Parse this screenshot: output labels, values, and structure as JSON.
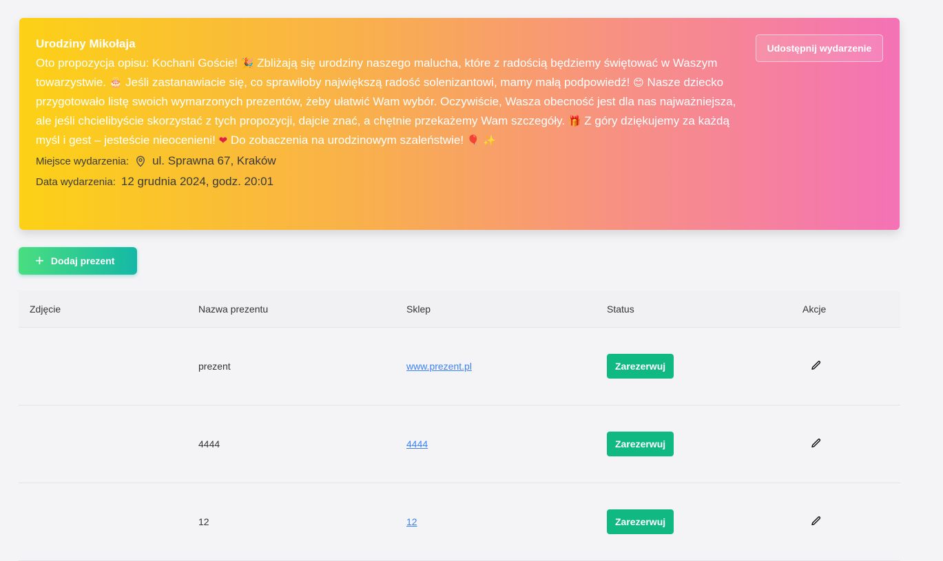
{
  "event": {
    "title": "Urodziny Mikołaja",
    "description_parts": [
      "Oto propozycja opisu: Kochani Goście! ",
      " Zbliżają się urodziny naszego malucha, które z radością będziemy świętować w Waszym towarzystwie. ",
      " Jeśli zastanawiacie się, co sprawiłoby największą radość solenizantowi, mamy małą podpowiedź! ",
      " Nasze dziecko przygotowało listę swoich wymarzonych prezentów, żeby ułatwić Wam wybór. Oczywiście, Wasza obecność jest dla nas najważniejsza, ale jeśli chcielibyście skorzystać z tych propozycji, dajcie znać, a chętnie przekażemy Wam szczegóły. ",
      " Z góry dziękujemy za każdą myśl i gest – jesteście nieocenieni! ",
      " Do zobaczenia na urodzinowym szaleństwie! "
    ],
    "emojis": [
      "🎉",
      "🎂",
      "😊",
      "🎁",
      "❤",
      "🎈",
      "✨"
    ],
    "location_label": "Miejsce wydarzenia:",
    "location_value": "ul. Sprawna 67, Kraków",
    "date_label": "Data wydarzenia:",
    "date_value": "12 grudnia 2024, godz. 20:01",
    "share_label": "Udostępnij wydarzenie"
  },
  "add_gift_label": "Dodaj prezent",
  "table": {
    "headers": [
      "Zdjęcie",
      "Nazwa prezentu",
      "Sklep",
      "Status",
      "Akcje"
    ],
    "rows": [
      {
        "name": "prezent",
        "shop": "www.prezent.pl",
        "status": "Zarezerwuj"
      },
      {
        "name": "4444",
        "shop": "4444",
        "status": "Zarezerwuj"
      },
      {
        "name": "12",
        "shop": "12",
        "status": "Zarezerwuj"
      }
    ]
  },
  "colors": {
    "gradient_start": "#fcd116",
    "gradient_end": "#f472b6",
    "reserve_green": "#10b981",
    "link_blue": "#3b82f6"
  }
}
